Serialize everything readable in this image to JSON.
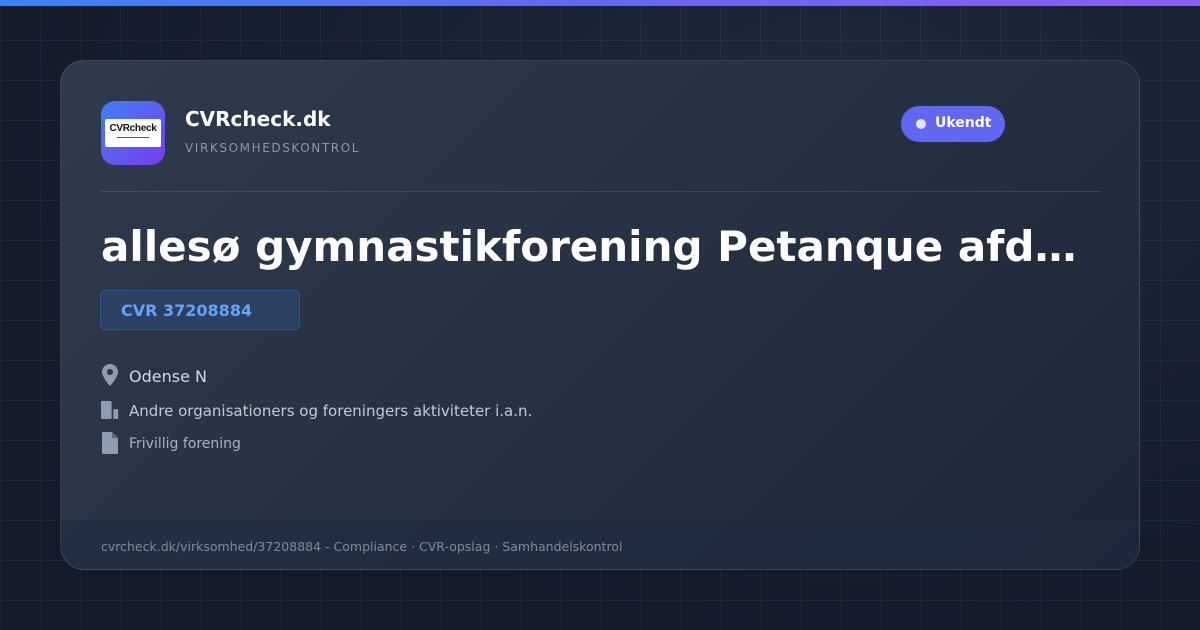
{
  "colors": {
    "accent": "#6366f1",
    "cvr_text": "#60a5fa",
    "background": "#141d2e",
    "card": "#2a3547"
  },
  "brand": {
    "logo_text": "CVRcheck",
    "name": "CVRcheck.dk",
    "tagline": "VIRKSOMHEDSKONTROL"
  },
  "status": {
    "label": "Ukendt"
  },
  "company": {
    "name": "allesø gymnastikforening Petanque afdeling",
    "cvr": "CVR 37208884"
  },
  "details": {
    "location": {
      "icon": "location-pin-icon",
      "text": "Odense N"
    },
    "industry": {
      "icon": "building-icon",
      "text": "Andre organisationers og foreningers aktiviteter i.a.n."
    },
    "type": {
      "icon": "document-icon",
      "text": "Frivillig forening"
    }
  },
  "footer": {
    "text": "cvrcheck.dk/virksomhed/37208884 - Compliance · CVR-opslag · Samhandelskontrol"
  }
}
